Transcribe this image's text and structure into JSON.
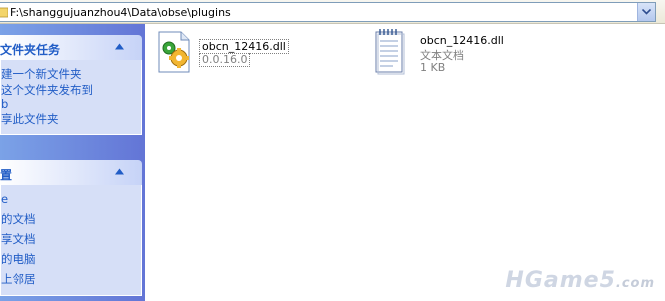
{
  "address": {
    "path": "F:\\shanggujuanzhou4\\Data\\obse\\plugins"
  },
  "taskpane": {
    "file_tasks": {
      "title": "文件夹任务",
      "items": [
        "建一个新文件夹",
        "这个文件夹发布到",
        "b",
        "享此文件夹"
      ]
    },
    "other_places": {
      "title": "置",
      "items": [
        "e",
        "的文档",
        "享文档",
        "的电脑",
        "上邻居"
      ]
    }
  },
  "files": [
    {
      "name": "obcn_12416.dll",
      "detail": "0.0.16.0",
      "icon": "dll-gear-icon"
    },
    {
      "name": "obcn_12416.dll",
      "detail": "文本文档",
      "size": "1 KB",
      "icon": "notepad-icon"
    }
  ],
  "watermark": {
    "text": "HGame5",
    "suffix": ".com"
  },
  "colors": {
    "taskpane": "#7ba2e7",
    "link": "#215dc6",
    "header": "#c6d3f7"
  }
}
